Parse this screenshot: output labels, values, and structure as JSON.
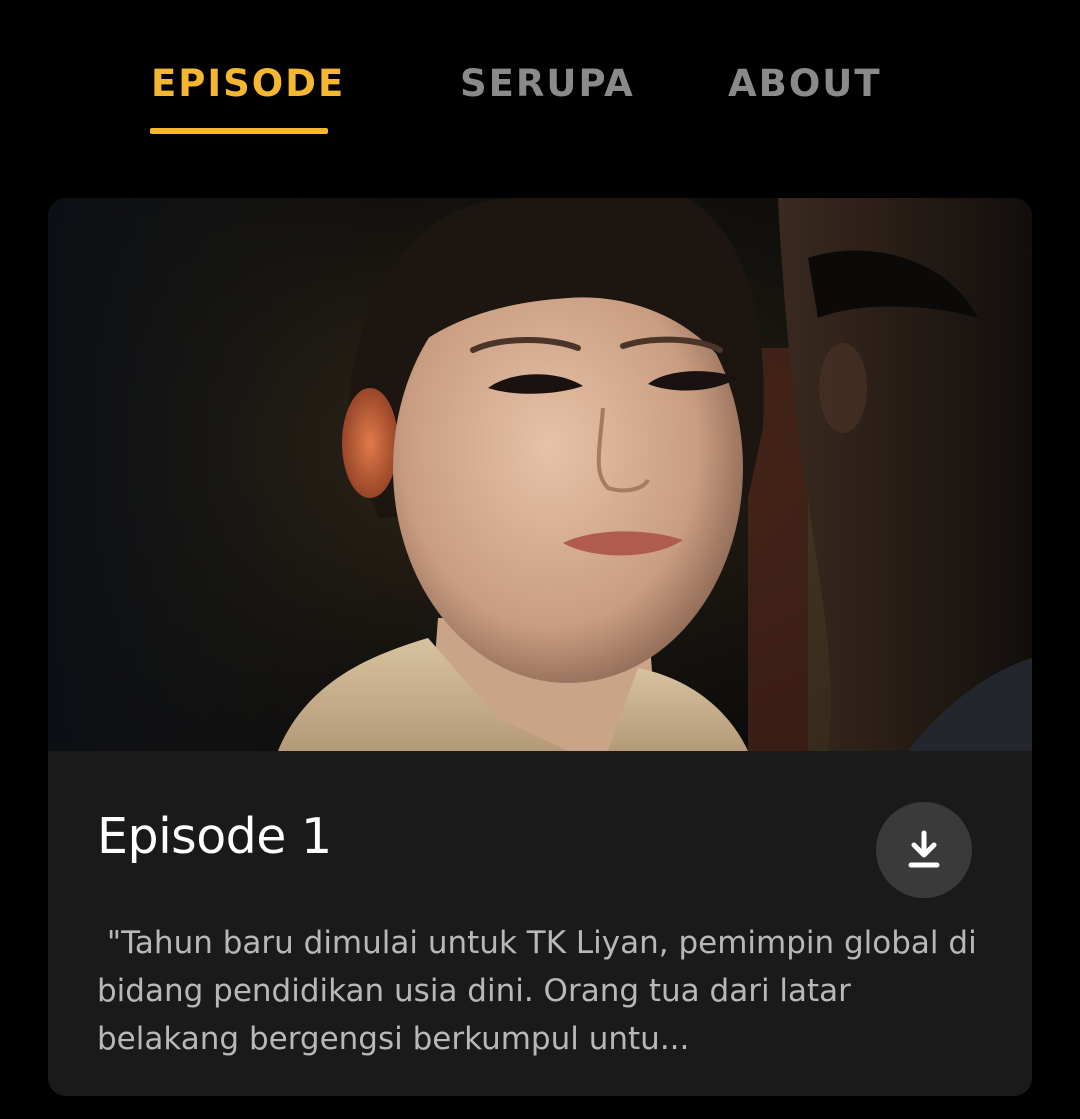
{
  "tabs": [
    {
      "label": "EPISODE",
      "active": true
    },
    {
      "label": "SERUPA",
      "active": false
    },
    {
      "label": "ABOUT",
      "active": false
    }
  ],
  "colors": {
    "accent": "#f5b731",
    "tab_inactive": "#8a8a8a",
    "background": "#000000",
    "card": "#1a1a1a",
    "description": "#b8b8b8"
  },
  "episode": {
    "thumbnail_icon": "video-thumbnail",
    "title": "Episode 1",
    "download_icon": "download-icon",
    "description": " \"Tahun baru dimulai untuk TK Liyan, pemimpin global di bidang pendidikan usia dini. Orang tua dari latar belakang bergengsi berkumpul untu..."
  }
}
